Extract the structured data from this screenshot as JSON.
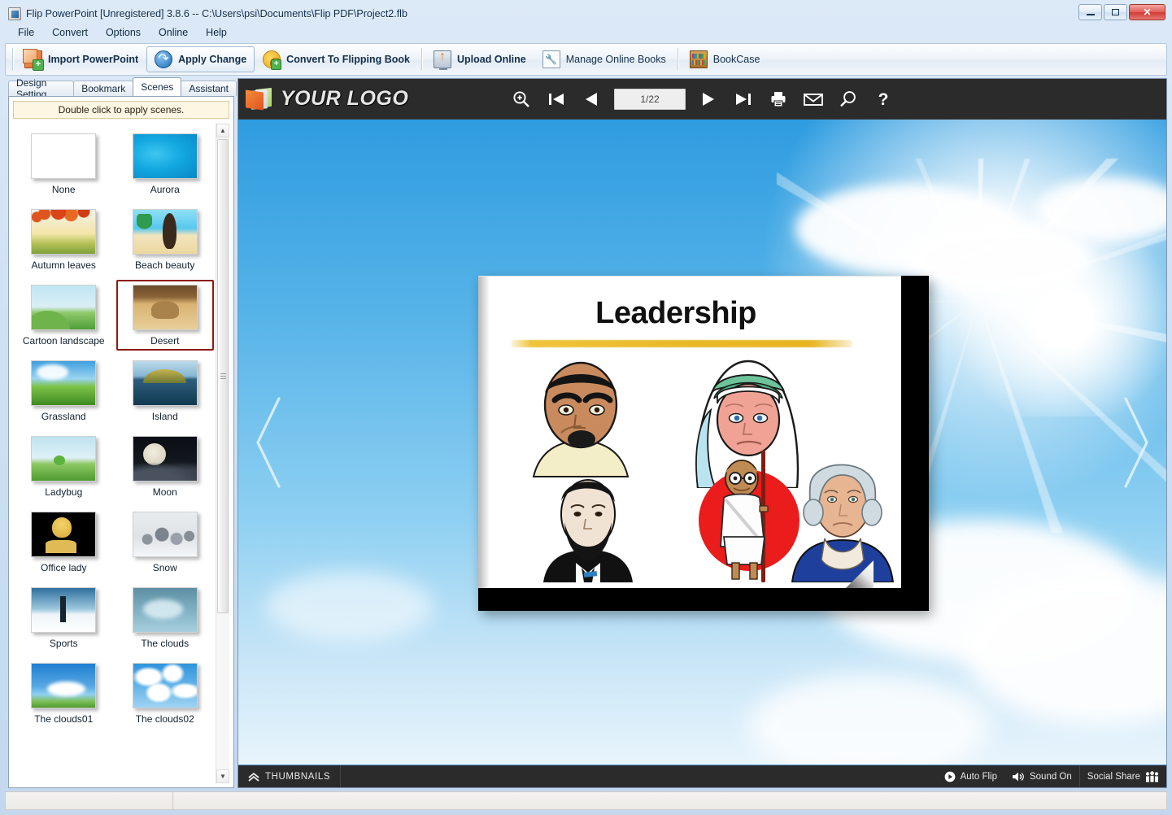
{
  "window": {
    "title": "Flip PowerPoint [Unregistered] 3.8.6  -- C:\\Users\\psi\\Documents\\Flip PDF\\Project2.flb",
    "app_icon": "flip-powerpoint-icon",
    "controls": {
      "minimize": "minimize-button",
      "maximize": "maximize-button",
      "close": "✕"
    }
  },
  "menu": [
    {
      "label": "File"
    },
    {
      "label": "Convert"
    },
    {
      "label": "Options"
    },
    {
      "label": "Online"
    },
    {
      "label": "Help"
    }
  ],
  "toolbar": [
    {
      "label": "Import PowerPoint",
      "icon": "import-powerpoint-icon",
      "bold": true,
      "raised": false
    },
    {
      "label": "Apply Change",
      "icon": "apply-change-icon",
      "bold": true,
      "raised": true
    },
    {
      "label": "Convert To Flipping Book",
      "icon": "convert-flipping-book-icon",
      "bold": true,
      "raised": false
    },
    {
      "label": "Upload Online",
      "icon": "upload-online-icon",
      "bold": true,
      "raised": false
    },
    {
      "label": "Manage Online Books",
      "icon": "manage-online-books-icon",
      "bold": false,
      "raised": false
    },
    {
      "label": "BookCase",
      "icon": "bookcase-icon",
      "bold": false,
      "raised": false
    }
  ],
  "left_panel": {
    "tabs": [
      {
        "label": "Design Setting",
        "active": false
      },
      {
        "label": "Bookmark",
        "active": false
      },
      {
        "label": "Scenes",
        "active": true
      },
      {
        "label": "Assistant",
        "active": false
      }
    ],
    "hint": "Double click to apply scenes.",
    "scenes": [
      {
        "label": "None",
        "art": "t-none",
        "selected": false
      },
      {
        "label": "Aurora",
        "art": "t-aurora",
        "selected": false
      },
      {
        "label": "Autumn leaves",
        "art": "t-autumn",
        "selected": false
      },
      {
        "label": "Beach beauty",
        "art": "t-beach",
        "selected": false
      },
      {
        "label": "Cartoon landscape",
        "art": "t-cartoon",
        "selected": false
      },
      {
        "label": "Desert",
        "art": "t-desert",
        "selected": true
      },
      {
        "label": "Grassland",
        "art": "t-grass",
        "selected": false
      },
      {
        "label": "Island",
        "art": "t-island",
        "selected": false
      },
      {
        "label": "Ladybug",
        "art": "t-ladybug",
        "selected": false
      },
      {
        "label": "Moon",
        "art": "t-moon",
        "selected": false
      },
      {
        "label": "Office lady",
        "art": "t-office",
        "selected": false
      },
      {
        "label": "Snow",
        "art": "t-snow",
        "selected": false
      },
      {
        "label": "Sports",
        "art": "t-sports",
        "selected": false
      },
      {
        "label": "The clouds",
        "art": "t-clouds",
        "selected": false
      },
      {
        "label": "The clouds01",
        "art": "t-clouds01",
        "selected": false
      },
      {
        "label": "The clouds02",
        "art": "t-clouds02",
        "selected": false
      }
    ],
    "scrollbar": {
      "up": "▲",
      "down": "▼"
    }
  },
  "viewer": {
    "logo_text": "YOUR LOGO",
    "logo_icon": "book-pages-logo-icon",
    "page_indicator": "1/22",
    "tools": [
      {
        "name": "zoom-in-icon"
      },
      {
        "name": "first-page-icon"
      },
      {
        "name": "previous-page-icon"
      },
      {
        "name": "next-page-icon"
      },
      {
        "name": "last-page-icon"
      },
      {
        "name": "print-icon"
      },
      {
        "name": "email-icon"
      },
      {
        "name": "search-icon"
      },
      {
        "name": "help-icon"
      }
    ],
    "nav_left": "previous-page-arrow",
    "nav_right": "next-page-arrow",
    "slide": {
      "title": "Leadership",
      "figures": [
        "martin-luther-king-figure",
        "mother-teresa-figure",
        "abraham-lincoln-figure",
        "mahatma-gandhi-figure",
        "george-washington-figure"
      ]
    },
    "bottom_bar": {
      "thumbnails": "THUMBNAILS",
      "auto_flip": "Auto Flip",
      "sound": "Sound On",
      "social_share": "Social Share"
    }
  },
  "status_bar": {
    "left": "",
    "right": ""
  },
  "colors": {
    "accent_blue": "#4a90c4",
    "selection_red": "#8b1a12",
    "viewer_chrome": "#2b2b2b",
    "sky_blue": "#56b3e8",
    "slide_underline": "#eab928"
  }
}
